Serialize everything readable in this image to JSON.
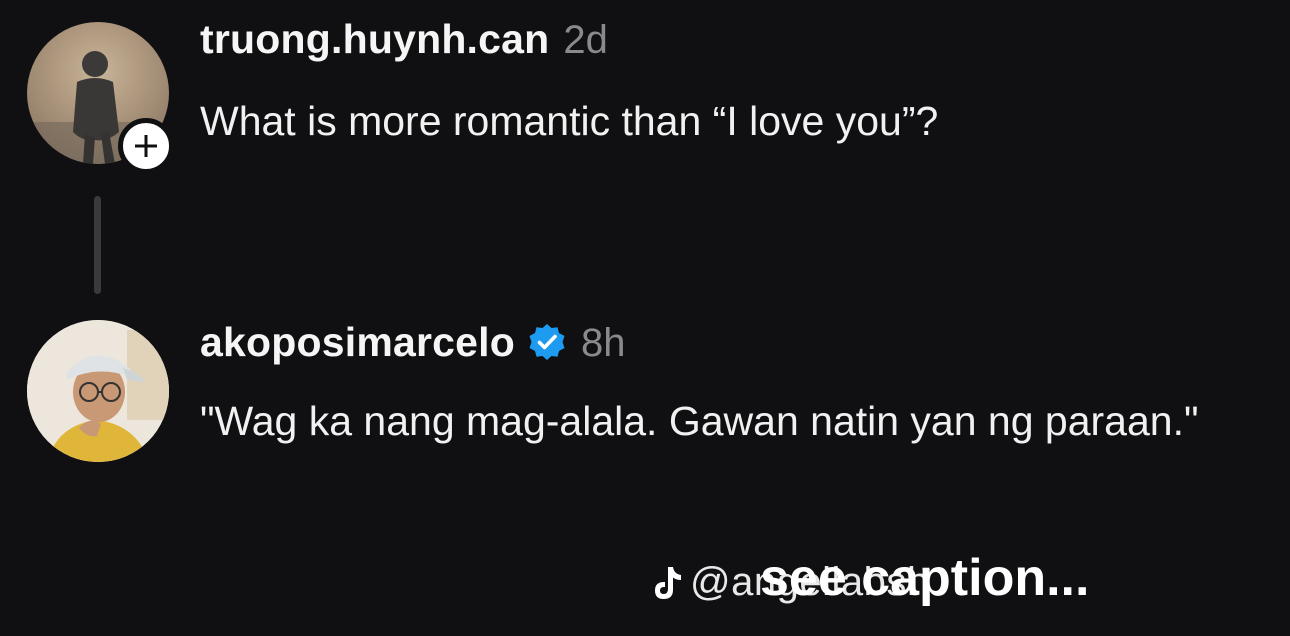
{
  "posts": [
    {
      "username": "truong.huynh.can",
      "time": "2d",
      "text": "What is more romantic than “I love you”?",
      "verified": false,
      "avatar_icon": "person-silhouette-avatar"
    },
    {
      "username": "akoposimarcelo",
      "time": "8h",
      "text": "\"Wag ka nang mag-alala. Gawan natin yan ng paraan.\"",
      "verified": true,
      "avatar_icon": "person-photo-avatar"
    }
  ],
  "overlay": {
    "handle": "@angellabsh",
    "caption": "see caption..."
  },
  "colors": {
    "background": "#101012",
    "verified_blue": "#1d9bf0",
    "muted": "#8a8a8e"
  }
}
